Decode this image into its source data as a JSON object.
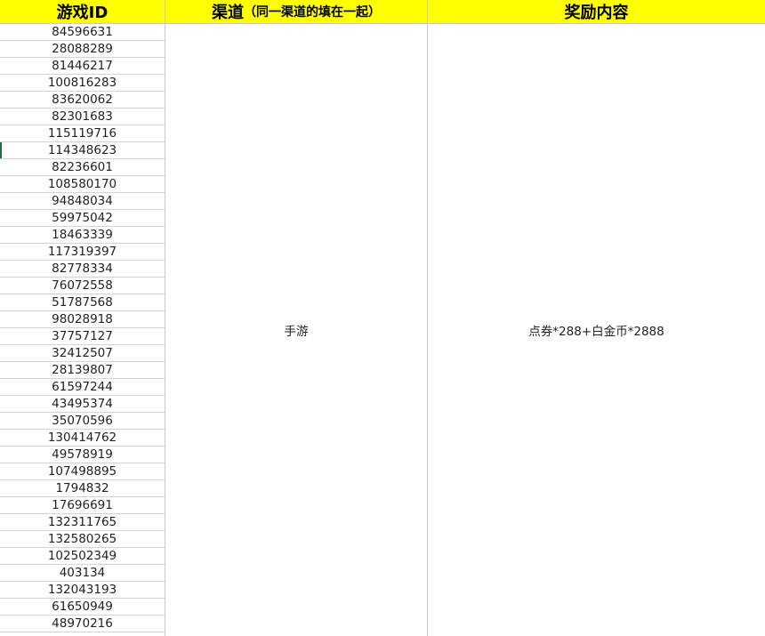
{
  "headers": {
    "game_id": "游戏ID",
    "channel_main": "渠道",
    "channel_note": "（同一渠道的填在一起）",
    "reward": "奖励内容"
  },
  "game_ids": [
    "84596631",
    "28088289",
    "81446217",
    "100816283",
    "83620062",
    "82301683",
    "115119716",
    "114348623",
    "82236601",
    "108580170",
    "94848034",
    "59975042",
    "18463339",
    "117319397",
    "82778334",
    "76072558",
    "51787568",
    "98028918",
    "37757127",
    "32412507",
    "28139807",
    "61597244",
    "43495374",
    "35070596",
    "130414762",
    "49578919",
    "107498895",
    "1794832",
    "17696691",
    "132311765",
    "132580265",
    "102502349",
    "403134",
    "132043193",
    "61650949",
    "48970216"
  ],
  "channel_value": "手游",
  "reward_value": "点券*288+白金币*2888",
  "colors": {
    "header_bg": "#ffff00",
    "grid": "#d4d4d4",
    "active_cell_marker": "#1e7145"
  }
}
